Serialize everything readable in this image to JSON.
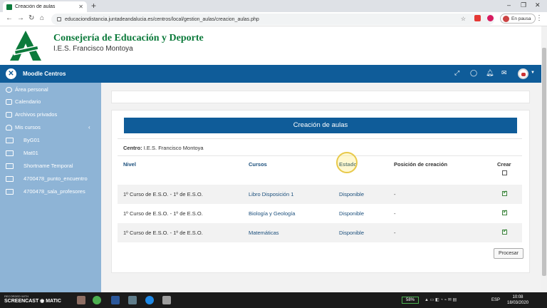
{
  "browser": {
    "tab_title": "Creación de aulas",
    "url": "educaciondistancia.juntadeandalucia.es/centros/local/gestion_aulas/creacion_aulas.php",
    "profile_status": "En pausa"
  },
  "header": {
    "org_name": "Consejería de Educación y Deporte",
    "school_name": "I.E.S. Francisco Montoya",
    "brand_color": "#0c7a3b"
  },
  "navbar": {
    "title": "Moodle Centros",
    "color": "#0f5c99",
    "icons": [
      "fullscreen-icon",
      "chat-icon",
      "bell-icon",
      "mail-icon",
      "user-avatar"
    ]
  },
  "sidebar": {
    "items": [
      {
        "label": "Área personal",
        "icon": "dashboard-icon"
      },
      {
        "label": "Calendario",
        "icon": "calendar-icon"
      },
      {
        "label": "Archivos privados",
        "icon": "file-icon"
      },
      {
        "label": "Mis cursos",
        "icon": "graduation-cap-icon"
      },
      {
        "label": "ByG01",
        "icon": "folder-icon"
      },
      {
        "label": "Mat01",
        "icon": "folder-icon"
      },
      {
        "label": "Shortname Temporal",
        "icon": "folder-icon"
      },
      {
        "label": "4700478_punto_encuentro",
        "icon": "folder-icon"
      },
      {
        "label": "4700478_sala_profesores",
        "icon": "folder-icon"
      }
    ]
  },
  "main": {
    "banner": "Creación de aulas",
    "centro_label": "Centro:",
    "centro_value": "I.E.S. Francisco Montoya",
    "headers": {
      "nivel": "Nivel",
      "cursos": "Cursos",
      "estado": "Estado",
      "posicion": "Posición de creación",
      "crear": "Crear"
    },
    "rows": [
      {
        "nivel": "1º Curso de E.S.O. - 1º de E.S.O.",
        "curso": "Libro Disposición 1",
        "estado": "Disponible",
        "posicion": "-",
        "crear": true
      },
      {
        "nivel": "1º Curso de E.S.O. - 1º de E.S.O.",
        "curso": "Biología y Geología",
        "estado": "Disponible",
        "posicion": "-",
        "crear": true
      },
      {
        "nivel": "1º Curso de E.S.O. - 1º de E.S.O.",
        "curso": "Matemáticas",
        "estado": "Disponible",
        "posicion": "-",
        "crear": true
      }
    ],
    "submit_label": "Procesar"
  },
  "taskbar": {
    "recorder_top": "RECORDED WITH",
    "recorder_name": "SCREENCAST ◉ MATIC",
    "battery": "58%",
    "lang": "ESP",
    "time": "10:08",
    "date": "18/03/2020"
  }
}
